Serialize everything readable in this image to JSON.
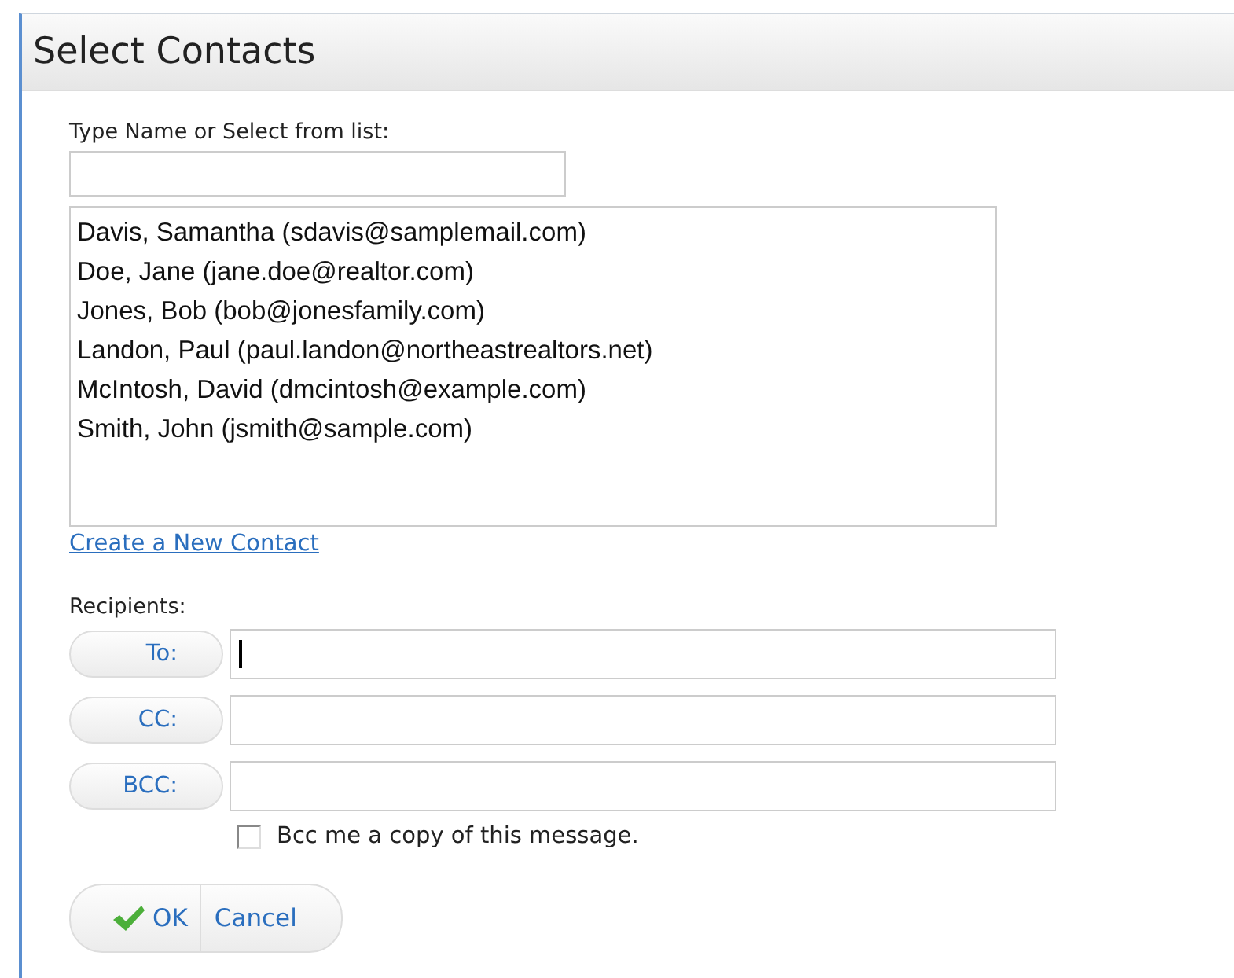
{
  "window": {
    "title": "Select Contacts"
  },
  "search": {
    "label": "Type Name or Select from list:"
  },
  "contacts": [
    "Davis, Samantha (sdavis@samplemail.com)",
    "Doe, Jane (jane.doe@realtor.com)",
    "Jones, Bob (bob@jonesfamily.com)",
    "Landon, Paul (paul.landon@northeastrealtors.net)",
    "McIntosh, David (dmcintosh@example.com)",
    "Smith, John (jsmith@sample.com)"
  ],
  "create_link": "Create a New Contact",
  "recipients": {
    "label": "Recipients:",
    "rows": [
      {
        "button": "To:",
        "focused": true
      },
      {
        "button": "CC:",
        "focused": false
      },
      {
        "button": "BCC:",
        "focused": false
      }
    ]
  },
  "bcc_me": {
    "label": "Bcc me a copy of this message.",
    "checked": false
  },
  "buttons": {
    "ok": "OK",
    "cancel": "Cancel"
  }
}
